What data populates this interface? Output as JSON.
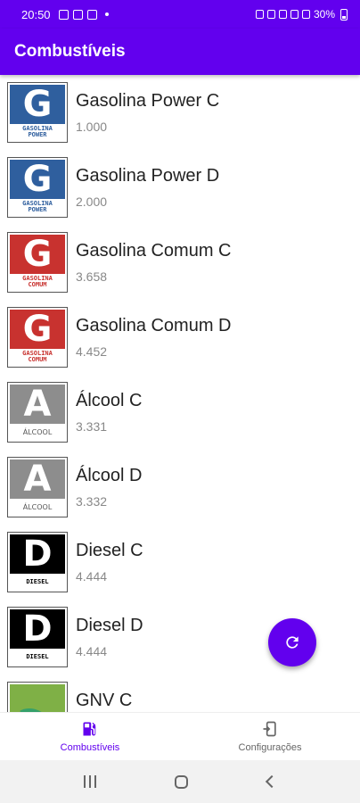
{
  "status_bar": {
    "time": "20:50",
    "battery": "30%"
  },
  "app_bar": {
    "title": "Combustíveis"
  },
  "fuels": [
    {
      "name": "Gasolina Power C",
      "value": "1.000",
      "logo_letter": "G",
      "logo_text": [
        "GASOLINA",
        "POWER"
      ]
    },
    {
      "name": "Gasolina Power D",
      "value": "2.000",
      "logo_letter": "G",
      "logo_text": [
        "GASOLINA",
        "POWER"
      ]
    },
    {
      "name": "Gasolina Comum C",
      "value": "3.658",
      "logo_letter": "G",
      "logo_text": [
        "GASOLINA",
        "COMUM"
      ]
    },
    {
      "name": "Gasolina Comum D",
      "value": "4.452",
      "logo_letter": "G",
      "logo_text": [
        "GASOLINA",
        "COMUM"
      ]
    },
    {
      "name": "Álcool C",
      "value": "3.331",
      "logo_letter": "A",
      "logo_text": [
        "ÁLCOOL"
      ]
    },
    {
      "name": "Álcool D",
      "value": "3.332",
      "logo_letter": "A",
      "logo_text": [
        "ÁLCOOL"
      ]
    },
    {
      "name": "Diesel C",
      "value": "4.444",
      "logo_letter": "D",
      "logo_text": [
        "DIESEL"
      ]
    },
    {
      "name": "Diesel D",
      "value": "4.444",
      "logo_letter": "D",
      "logo_text": [
        "DIESEL"
      ]
    },
    {
      "name": "GNV C",
      "value": ""
    }
  ],
  "fab": {
    "icon": "refresh-icon"
  },
  "bottom_nav": {
    "tabs": [
      {
        "label": "Combustíveis",
        "icon": "fuel-pump-icon",
        "active": true
      },
      {
        "label": "Configurações",
        "icon": "settings-export-icon",
        "active": false
      }
    ]
  },
  "colors": {
    "primary": "#6200ee",
    "power": "#2f5f9e",
    "comum": "#c8322f",
    "alcool": "#8d8d8d",
    "diesel": "#000000",
    "gnv": "#7fb046"
  }
}
